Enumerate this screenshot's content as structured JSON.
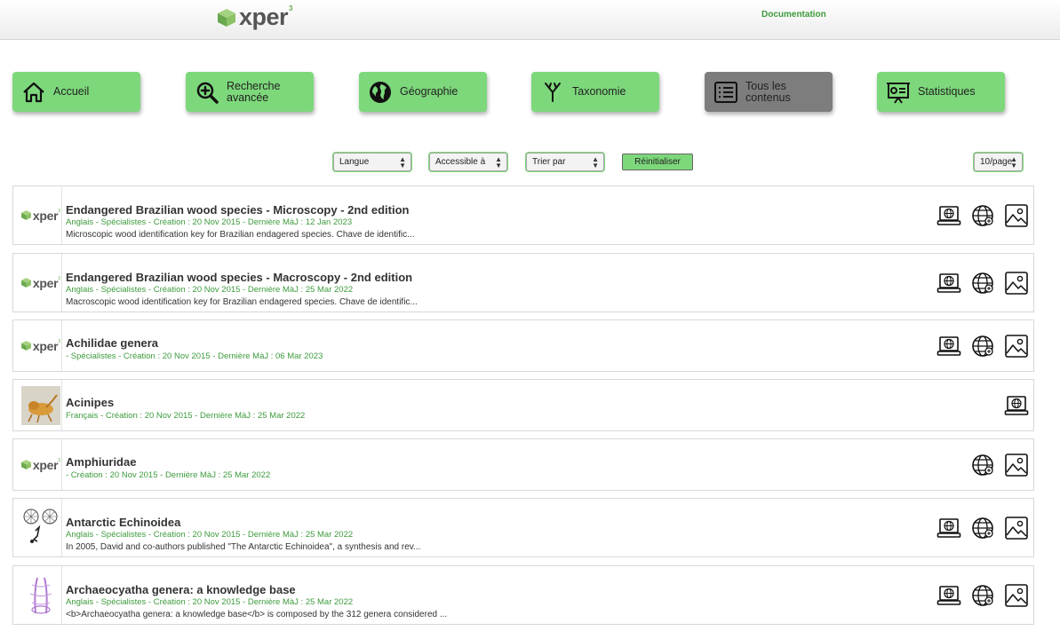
{
  "header": {
    "logo_text": "xper",
    "logo_sup": "3",
    "documentation": "Documentation"
  },
  "nav": [
    {
      "label": "Accueil",
      "icon": "home-icon",
      "active": false
    },
    {
      "label": "Recherche avancée",
      "icon": "zoom-in-icon",
      "active": false
    },
    {
      "label": "Géographie",
      "icon": "globe-icon",
      "active": false
    },
    {
      "label": "Taxonomie",
      "icon": "taxonomy-tree-icon",
      "active": false
    },
    {
      "label": "Tous les contenus",
      "icon": "list-icon",
      "active": true
    },
    {
      "label": "Statistiques",
      "icon": "statistics-icon",
      "active": false
    }
  ],
  "filters": {
    "langue": "Langue",
    "accessible": "Accessible à",
    "trier": "Trier par",
    "reset": "Réinitialiser",
    "per_page": "10/page"
  },
  "items": [
    {
      "title": "Endangered Brazilian wood species - Microscopy - 2nd edition",
      "meta": "Anglais - Spécialistes - Création : 20 Nov 2015 - Dernière MàJ : 12 Jan 2023",
      "desc": "Microscopic wood identification key for Brazilian endagered species. Chave de identific..."
    },
    {
      "title": "Endangered Brazilian wood species - Macroscopy - 2nd edition",
      "meta": "Anglais - Spécialistes - Création : 20 Nov 2015 - Dernière MàJ : 25 Mar 2022",
      "desc": "Macroscopic wood identification key for Brazilian endagered species. Chave de identific..."
    },
    {
      "title": "Achilidae genera",
      "meta": "- Spécialistes - Création : 20 Nov 2015 - Dernière MàJ : 06 Mar 2023",
      "desc": ""
    },
    {
      "title": "Acinipes",
      "meta": "Français - Création : 20 Nov 2015 - Dernière MàJ : 25 Mar 2022",
      "desc": ""
    },
    {
      "title": "Amphiuridae",
      "meta": "- Création : 20 Nov 2015 - Dernière MàJ : 25 Mar 2022",
      "desc": ""
    },
    {
      "title": "Antarctic Echinoidea",
      "meta": "Anglais - Spécialistes - Création : 20 Nov 2015 - Dernière MàJ : 25 Mar 2022",
      "desc": "In 2005, David and co-authors published \"The Antarctic Echinoidea\", a synthesis and rev..."
    },
    {
      "title": "Archaeocyatha genera: a knowledge base",
      "meta": "Anglais - Spécialistes - Création : 20 Nov 2015 - Dernière MàJ : 25 Mar 2022",
      "desc": "<b>Archaeocyatha genera: a knowledge base</b> is composed by the 312 genera considered ..."
    }
  ],
  "colors": {
    "accent_green": "#7dd87b",
    "meta_green": "#3d9b3d",
    "active_tile": "#7d7d7d"
  }
}
